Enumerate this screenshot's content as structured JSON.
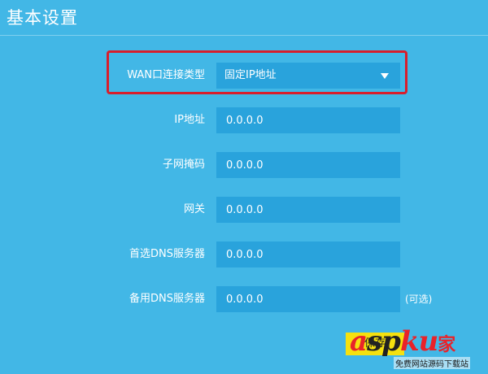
{
  "page": {
    "title": "基本设置"
  },
  "form": {
    "wan_type": {
      "label": "WAN口连接类型",
      "value": "固定IP地址"
    },
    "ip_address": {
      "label": "IP地址",
      "value": "0.0.0.0"
    },
    "subnet_mask": {
      "label": "子网掩码",
      "value": "0.0.0.0"
    },
    "gateway": {
      "label": "网关",
      "value": "0.0.0.0"
    },
    "primary_dns": {
      "label": "首选DNS服务器",
      "value": "0.0.0.0"
    },
    "secondary_dns": {
      "label": "备用DNS服务器",
      "value": "0.0.0.0",
      "optional_note": "(可选)"
    }
  },
  "actions": {
    "save_label": "保存"
  },
  "watermark": {
    "a": "a",
    "sp": "sp",
    "ku": "ku",
    "jia": "家",
    "subtitle": "免费网站源码下载站"
  },
  "colors": {
    "background": "#42b7e6",
    "field": "#29a3dc",
    "highlight_border": "#d81e2c",
    "save_button": "#f5e10f"
  }
}
